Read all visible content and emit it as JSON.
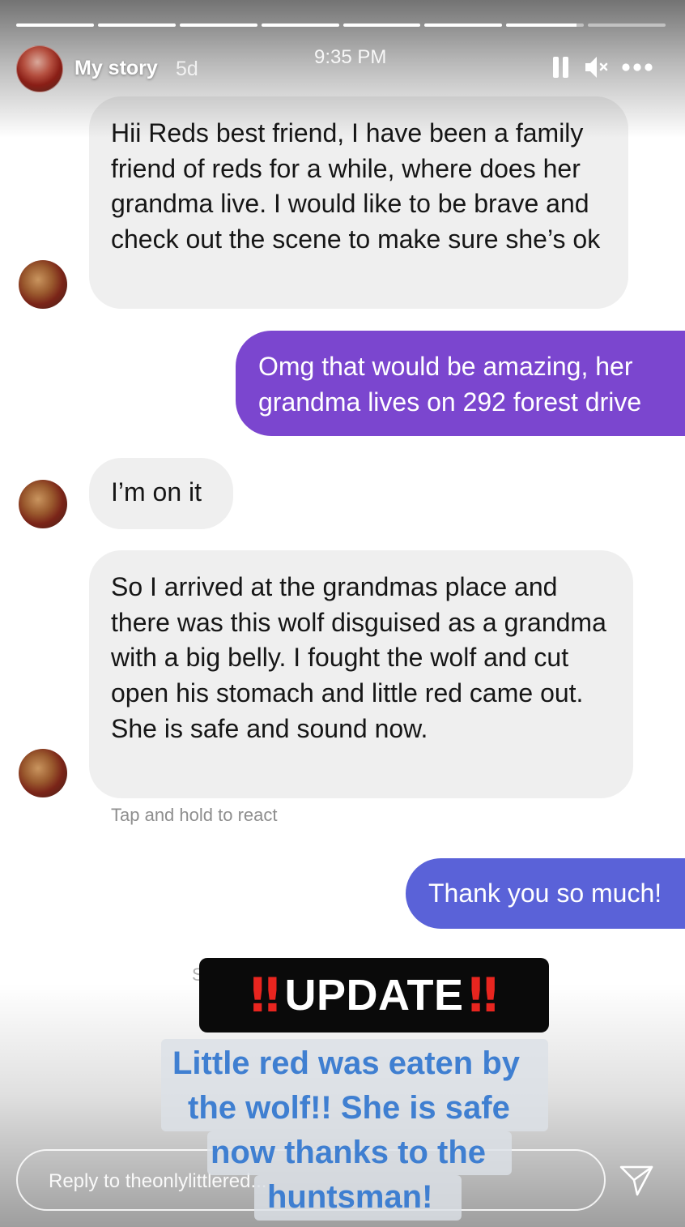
{
  "story_header": {
    "name": "My story",
    "age": "5d",
    "time": "9:35 PM",
    "progress_segments": [
      1,
      1,
      1,
      1,
      1,
      1,
      0.9,
      0
    ],
    "controls": [
      "pause-icon",
      "mute-icon",
      "more-icon"
    ]
  },
  "messages": [
    {
      "side": "in",
      "text": "Hii Reds best friend, I have been a family friend of reds for a while, where does her grandma live. I would like to be brave and check out the scene to make sure she’s ok"
    },
    {
      "side": "out",
      "lines": [
        "Omg that would be amazing, her",
        "grandma lives on 292 forest drive"
      ],
      "color": "#7b46cf"
    },
    {
      "side": "in",
      "text": "I’m on it"
    },
    {
      "side": "in",
      "text": "So I arrived at the grandmas place and there was this wolf disguised as a grandma with a big belly. I fought the wolf and cut open his stomach and little red came out. She is safe and sound now."
    },
    {
      "side": "out",
      "text": "Thank you so much!",
      "color": "#5a62d8"
    }
  ],
  "hint": "Tap and hold to react",
  "stickers": {
    "update": {
      "bang_left": "‼",
      "label": "UPDATE",
      "bang_right": "‼",
      "bang_color": "#e8251f"
    },
    "caption_lines": [
      "Little red was eaten by",
      "the wolf!! She is safe",
      "now thanks to the",
      "huntsman!"
    ],
    "caption_color": "#3f7fd1"
  },
  "reply": {
    "placeholder": "Reply to theonlylittlered..."
  },
  "send_icon": "paper-plane-icon"
}
